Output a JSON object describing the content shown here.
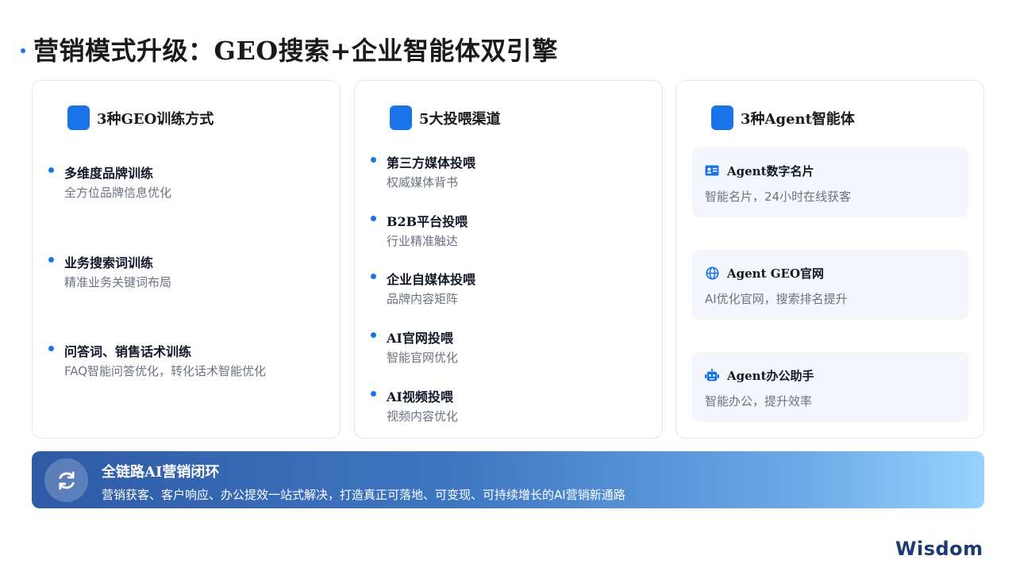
{
  "title": "营销模式升级：GEO搜索+企业智能体双引擎",
  "colors": {
    "accent": "#1a73e8",
    "card_border": "#e4e7ec",
    "agent_bg": "#f3f7fc",
    "banner_start": "#2e5aa6",
    "banner_end": "#97d2fd",
    "logo": "#1d3b73"
  },
  "cards": [
    {
      "heading": "3种GEO训练方式",
      "items": [
        {
          "title": "多维度品牌训练",
          "sub": "全方位品牌信息优化"
        },
        {
          "title": "业务搜索词训练",
          "sub": "精准业务关键词布局"
        },
        {
          "title": "问答词、销售话术训练",
          "sub": "FAQ智能问答优化，转化话术智能优化"
        }
      ]
    },
    {
      "heading": "5大投喂渠道",
      "items": [
        {
          "title": "第三方媒体投喂",
          "sub": "权威媒体背书"
        },
        {
          "title": "B2B平台投喂",
          "sub": "行业精准触达"
        },
        {
          "title": "企业自媒体投喂",
          "sub": "品牌内容矩阵"
        },
        {
          "title": "AI官网投喂",
          "sub": "智能官网优化"
        },
        {
          "title": "AI视频投喂",
          "sub": "视频内容优化"
        }
      ]
    },
    {
      "heading": "3种Agent智能体",
      "agents": [
        {
          "icon": "id-card-icon",
          "title": "Agent数字名片",
          "sub": "智能名片，24小时在线获客"
        },
        {
          "icon": "globe-icon",
          "title": "Agent GEO官网",
          "sub": "AI优化官网，搜索排名提升"
        },
        {
          "icon": "robot-icon",
          "title": "Agent办公助手",
          "sub": "智能办公，提升效率"
        }
      ]
    }
  ],
  "banner": {
    "icon": "refresh-icon",
    "title": "全链路AI营销闭环",
    "sub": "营销获客、客户响应、办公提效一站式解决，打造真正可落地、可变现、可持续增长的AI营销新通路"
  },
  "logo": "Wisdom"
}
